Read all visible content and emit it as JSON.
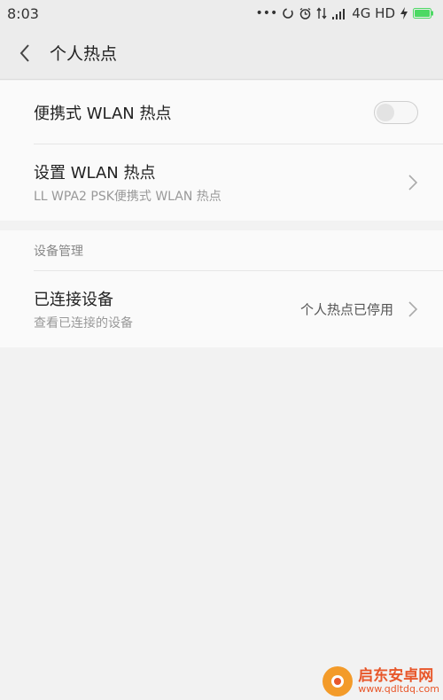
{
  "status_bar": {
    "time": "8:03",
    "dots": "•••",
    "network": "4G HD",
    "icons": [
      "sync-icon",
      "alarm-icon",
      "data-arrows-icon",
      "signal-icon",
      "charging-icon",
      "battery-icon"
    ],
    "battery_color": "#4cd964"
  },
  "header": {
    "title": "个人热点"
  },
  "hotspot_group": {
    "portable_label": "便携式 WLAN 热点",
    "portable_enabled": false,
    "setup_title": "设置 WLAN 热点",
    "setup_subtitle": "LL WPA2 PSK便携式 WLAN 热点"
  },
  "device_section": {
    "header": "设备管理",
    "connected_title": "已连接设备",
    "connected_subtitle": "查看已连接的设备",
    "connected_value": "个人热点已停用"
  },
  "watermark": {
    "title": "启东安卓网",
    "url": "www.qdltdq.com"
  }
}
